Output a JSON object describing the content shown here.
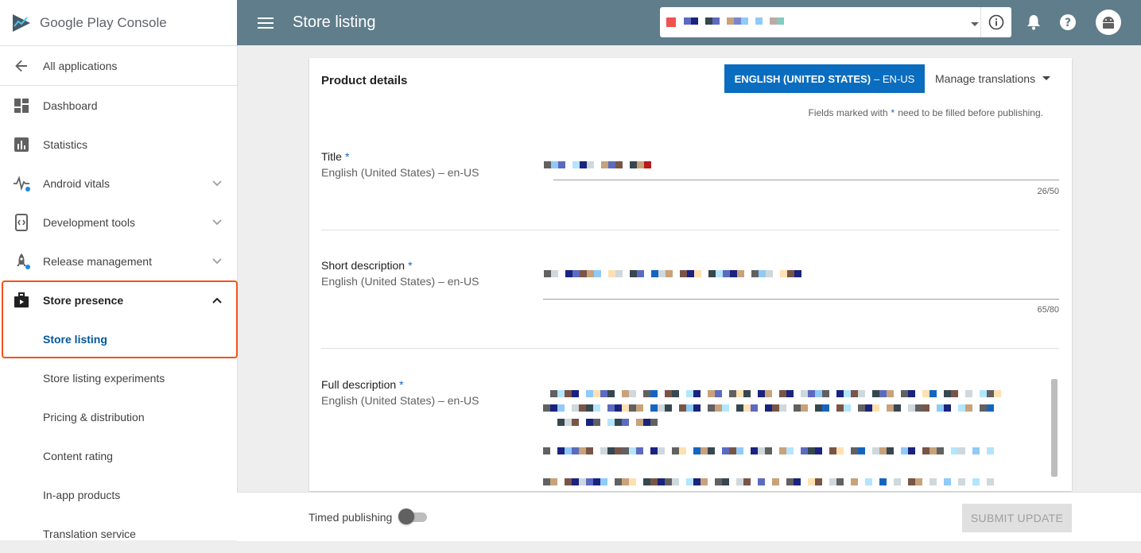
{
  "brand": {
    "name": "Google Play Console"
  },
  "sidebar": {
    "back_label": "All applications",
    "items": [
      {
        "label": "Dashboard",
        "icon": "dashboard-icon"
      },
      {
        "label": "Statistics",
        "icon": "bar-chart-icon"
      },
      {
        "label": "Android vitals",
        "icon": "pulse-icon"
      },
      {
        "label": "Development tools",
        "icon": "code-icon"
      },
      {
        "label": "Release management",
        "icon": "rocket-icon"
      },
      {
        "label": "Store presence",
        "icon": "briefcase-play-icon"
      }
    ],
    "subitems": [
      {
        "label": "Store listing"
      },
      {
        "label": "Store listing experiments"
      },
      {
        "label": "Pricing & distribution"
      },
      {
        "label": "Content rating"
      },
      {
        "label": "In-app products"
      },
      {
        "label": "Translation service"
      }
    ]
  },
  "topbar": {
    "title": "Store listing"
  },
  "card": {
    "heading": "Product details",
    "language_button": {
      "label": "ENGLISH (UNITED STATES)",
      "code": "– EN-US"
    },
    "manage_translations": "Manage translations",
    "required_note_pre": "Fields marked with",
    "required_star": "*",
    "required_note_post": "need to be filled before publishing.",
    "fields": [
      {
        "label": "Title",
        "star": "*",
        "sub": "English (United States) – en-US",
        "count": "26/50"
      },
      {
        "label": "Short description",
        "star": "*",
        "sub": "English (United States) – en-US",
        "count": "65/80"
      },
      {
        "label": "Full description",
        "star": "*",
        "sub": "English (United States) – en-US"
      }
    ]
  },
  "bottombar": {
    "timed_publishing": "Timed publishing",
    "timed_publishing_on": false,
    "submit_label": "SUBMIT UPDATE"
  },
  "colors": {
    "topbar": "#607d8b",
    "language_button": "#0b6dbf",
    "highlight": "#f4511e",
    "active_link": "#01579b"
  }
}
